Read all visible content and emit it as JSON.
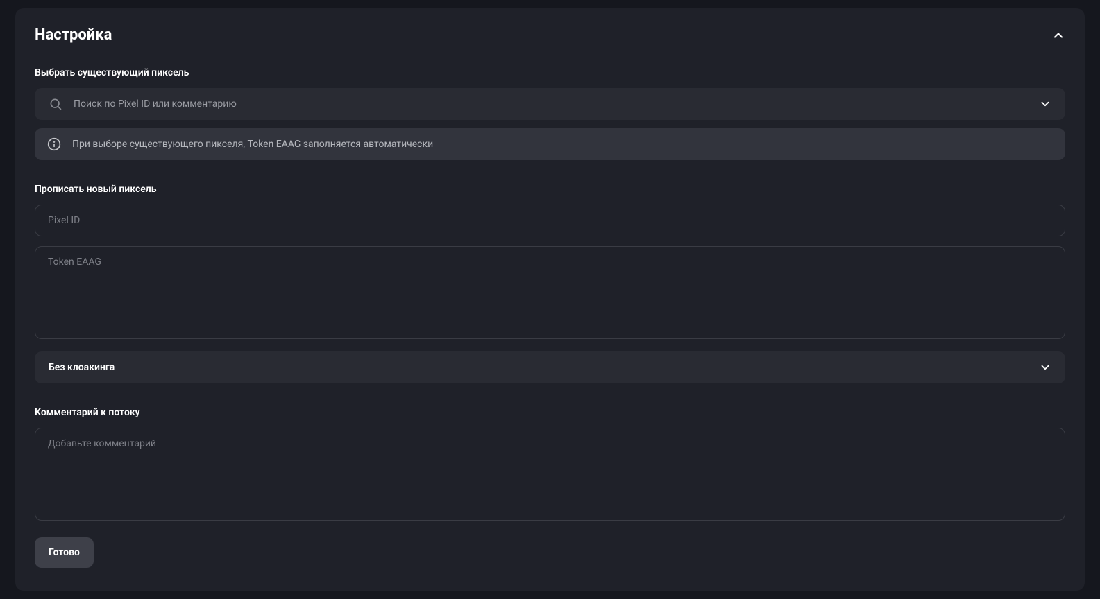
{
  "panel": {
    "title": "Настройка"
  },
  "select_pixel": {
    "label": "Выбрать существующий пиксель",
    "placeholder": "Поиск по Pixel ID или комментарию"
  },
  "info_banner": {
    "text": "При выборе существующего пикселя, Token EAAG заполняется автоматически"
  },
  "new_pixel": {
    "label": "Прописать новый пиксель",
    "pixel_id_placeholder": "Pixel ID",
    "token_placeholder": "Token EAAG"
  },
  "cloaking": {
    "selected": "Без клоакинга"
  },
  "comment": {
    "label": "Комментарий к потоку",
    "placeholder": "Добавьте комментарий"
  },
  "buttons": {
    "done": "Готово"
  }
}
